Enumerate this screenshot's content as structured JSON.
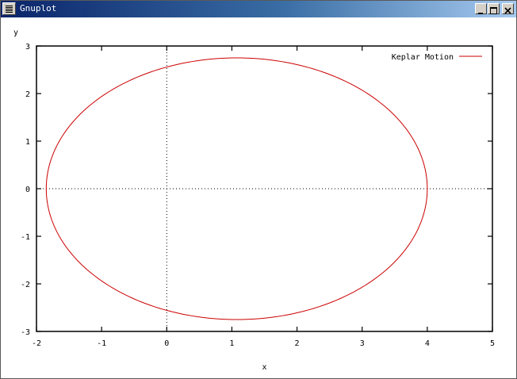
{
  "window": {
    "title": "Gnuplot"
  },
  "icons": {
    "system_menu": "menu-icon",
    "minimize": "minimize-icon",
    "maximize": "maximize-icon",
    "close": "close-icon"
  },
  "chart_data": {
    "type": "line",
    "title": "",
    "xlabel": "x",
    "ylabel": "y",
    "xlim": [
      -2,
      5
    ],
    "ylim": [
      -3,
      3
    ],
    "xticks": [
      "-2",
      "-1",
      "0",
      "1",
      "2",
      "3",
      "4",
      "5"
    ],
    "yticks": [
      "3",
      "2",
      "1",
      "0",
      "-1",
      "-2",
      "-3"
    ],
    "zero_axes": true,
    "grid": false,
    "legend_position": "top-right",
    "series": [
      {
        "name": "Keplar Motion",
        "color": "#cc0000",
        "curve": "ellipse",
        "center": [
          1.075,
          0
        ],
        "semi_axis_x": 2.925,
        "semi_axis_y": 2.75,
        "x_range": [
          -1.85,
          4.0
        ],
        "y_range": [
          -2.75,
          2.75
        ]
      }
    ]
  }
}
